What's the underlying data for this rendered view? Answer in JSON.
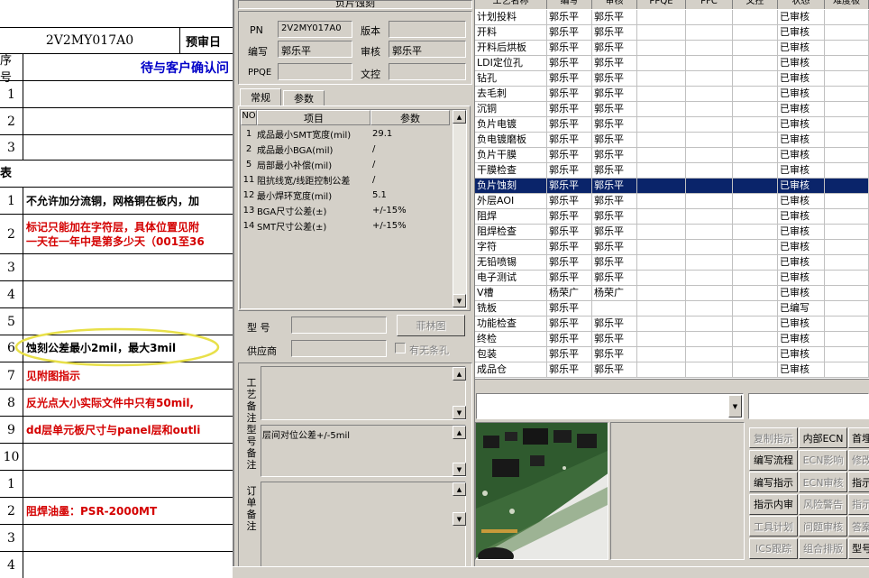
{
  "sheet": {
    "header_code": "2V2MY017A0",
    "header_right": "预审日",
    "col_no": "序号",
    "col_title": "待与客户确认问",
    "section_mark": "表",
    "rows": [
      {
        "num": "1",
        "text": ""
      },
      {
        "num": "2",
        "text": ""
      },
      {
        "num": "3",
        "text": ""
      },
      {
        "num": "1",
        "text": "不允许加分流铜，网格铜在板内，加"
      },
      {
        "num": "2",
        "text": "标记只能加在字符层，具体位置见附\n一天在一年中是第多少天（001至36"
      },
      {
        "num": "3",
        "text": ""
      },
      {
        "num": "4",
        "text": ""
      },
      {
        "num": "5",
        "text": ""
      },
      {
        "num": "6",
        "text": "蚀刻公差最小2mil，最大3mil"
      },
      {
        "num": "7",
        "text": "见附图指示"
      },
      {
        "num": "8",
        "text": "反光点大小实际文件中只有50mil,"
      },
      {
        "num": "9",
        "text": "dd层单元板尺寸与panel层和outli"
      },
      {
        "num": "10",
        "text": ""
      },
      {
        "num": "1",
        "text": ""
      },
      {
        "num": "2",
        "text": "阻焊油墨：PSR-2000MT"
      },
      {
        "num": "3",
        "text": ""
      },
      {
        "num": "4",
        "text": ""
      }
    ]
  },
  "panel": {
    "title": "负片蚀刻",
    "pn_label": "PN",
    "pn_value": "2V2MY017A0",
    "version_label": "版本",
    "version_value": "",
    "writer_label": "编写",
    "writer_value": "郭乐平",
    "reviewer_label": "审核",
    "reviewer_value": "郭乐平",
    "ppqe_label": "PPQE",
    "ppqe_value": "",
    "doc_label": "文控",
    "doc_value": "",
    "tabs": [
      "常规",
      "参数"
    ],
    "param_headers": [
      "NO",
      "项目",
      "参数"
    ],
    "params": [
      {
        "no": "1",
        "item": "成品最小SMT宽度(mil)",
        "val": "29.1"
      },
      {
        "no": "2",
        "item": "成品最小BGA(mil)",
        "val": "/"
      },
      {
        "no": "5",
        "item": "局部最小补偿(mil)",
        "val": "/"
      },
      {
        "no": "11",
        "item": "阻抗线宽/线距控制公差",
        "val": "/"
      },
      {
        "no": "12",
        "item": "最小焊环宽度(mil)",
        "val": "5.1"
      },
      {
        "no": "13",
        "item": "BGA尺寸公差(±)",
        "val": "+/-15%"
      },
      {
        "no": "14",
        "item": "SMT尺寸公差(±)",
        "val": "+/-15%"
      }
    ],
    "model_label": "型  号",
    "model_value": "",
    "fei_button": "菲林图",
    "supplier_label": "供应商",
    "supplier_value": "",
    "strip_checkbox": "有无条孔",
    "process_note_label": "工艺备注",
    "process_note": "",
    "model_note_label": "型号备注",
    "model_note": "层间对位公差+/-5mil",
    "order_note_label": "订单备注",
    "order_note": ""
  },
  "process": {
    "headers": [
      "工艺名称",
      "编写",
      "审核",
      "PPQE",
      "PFC",
      "文控",
      "状态",
      "难度极"
    ],
    "rows": [
      {
        "name": "计划投料",
        "writer": "郭乐平",
        "reviewer": "郭乐平",
        "status": "已审核"
      },
      {
        "name": "开料",
        "writer": "郭乐平",
        "reviewer": "郭乐平",
        "status": "已审核"
      },
      {
        "name": "开料后烘板",
        "writer": "郭乐平",
        "reviewer": "郭乐平",
        "status": "已审核"
      },
      {
        "name": "LDI定位孔",
        "writer": "郭乐平",
        "reviewer": "郭乐平",
        "status": "已审核"
      },
      {
        "name": "钻孔",
        "writer": "郭乐平",
        "reviewer": "郭乐平",
        "status": "已审核"
      },
      {
        "name": "去毛刺",
        "writer": "郭乐平",
        "reviewer": "郭乐平",
        "status": "已审核"
      },
      {
        "name": "沉铜",
        "writer": "郭乐平",
        "reviewer": "郭乐平",
        "status": "已审核"
      },
      {
        "name": "负片电镀",
        "writer": "郭乐平",
        "reviewer": "郭乐平",
        "status": "已审核"
      },
      {
        "name": "负电镀磨板",
        "writer": "郭乐平",
        "reviewer": "郭乐平",
        "status": "已审核"
      },
      {
        "name": "负片干膜",
        "writer": "郭乐平",
        "reviewer": "郭乐平",
        "status": "已审核"
      },
      {
        "name": "干膜检查",
        "writer": "郭乐平",
        "reviewer": "郭乐平",
        "status": "已审核"
      },
      {
        "name": "负片蚀刻",
        "writer": "郭乐平",
        "reviewer": "郭乐平",
        "status": "已审核"
      },
      {
        "name": "外层AOI",
        "writer": "郭乐平",
        "reviewer": "郭乐平",
        "status": "已审核"
      },
      {
        "name": "阻焊",
        "writer": "郭乐平",
        "reviewer": "郭乐平",
        "status": "已审核"
      },
      {
        "name": "阻焊检查",
        "writer": "郭乐平",
        "reviewer": "郭乐平",
        "status": "已审核"
      },
      {
        "name": "字符",
        "writer": "郭乐平",
        "reviewer": "郭乐平",
        "status": "已审核"
      },
      {
        "name": "无铅喷锡",
        "writer": "郭乐平",
        "reviewer": "郭乐平",
        "status": "已审核"
      },
      {
        "name": "电子测试",
        "writer": "郭乐平",
        "reviewer": "郭乐平",
        "status": "已审核"
      },
      {
        "name": "V槽",
        "writer": "杨荣广",
        "reviewer": "杨荣广",
        "status": "已审核"
      },
      {
        "name": "铣板",
        "writer": "郭乐平",
        "reviewer": "",
        "status": "已编写"
      },
      {
        "name": "功能检查",
        "writer": "郭乐平",
        "reviewer": "郭乐平",
        "status": "已审核"
      },
      {
        "name": "终检",
        "writer": "郭乐平",
        "reviewer": "郭乐平",
        "status": "已审核"
      },
      {
        "name": "包装",
        "writer": "郭乐平",
        "reviewer": "郭乐平",
        "status": "已审核"
      },
      {
        "name": "成品仓",
        "writer": "郭乐平",
        "reviewer": "郭乐平",
        "status": "已审核"
      }
    ],
    "selected_index": 11
  },
  "actions": [
    [
      "复制指示",
      "内部ECN",
      "首埋"
    ],
    [
      "编写流程",
      "ECN影响",
      "修改"
    ],
    [
      "编写指示",
      "ECN审核",
      "指示"
    ],
    [
      "指示内审",
      "风险警告",
      "指示"
    ],
    [
      "工具计划",
      "问题审核",
      "答案"
    ],
    [
      "ICS跟踪",
      "组合排版",
      "型号"
    ]
  ],
  "actions_disabled": [
    [
      true,
      false,
      false
    ],
    [
      false,
      true,
      true
    ],
    [
      false,
      true,
      false
    ],
    [
      false,
      true,
      true
    ],
    [
      true,
      true,
      true
    ],
    [
      true,
      true,
      false
    ]
  ],
  "colors": {
    "selection": "#0a246a",
    "red_text": "#d40000",
    "blue_text": "#0000c8",
    "highlight_ellipse": "#e8e04a"
  }
}
